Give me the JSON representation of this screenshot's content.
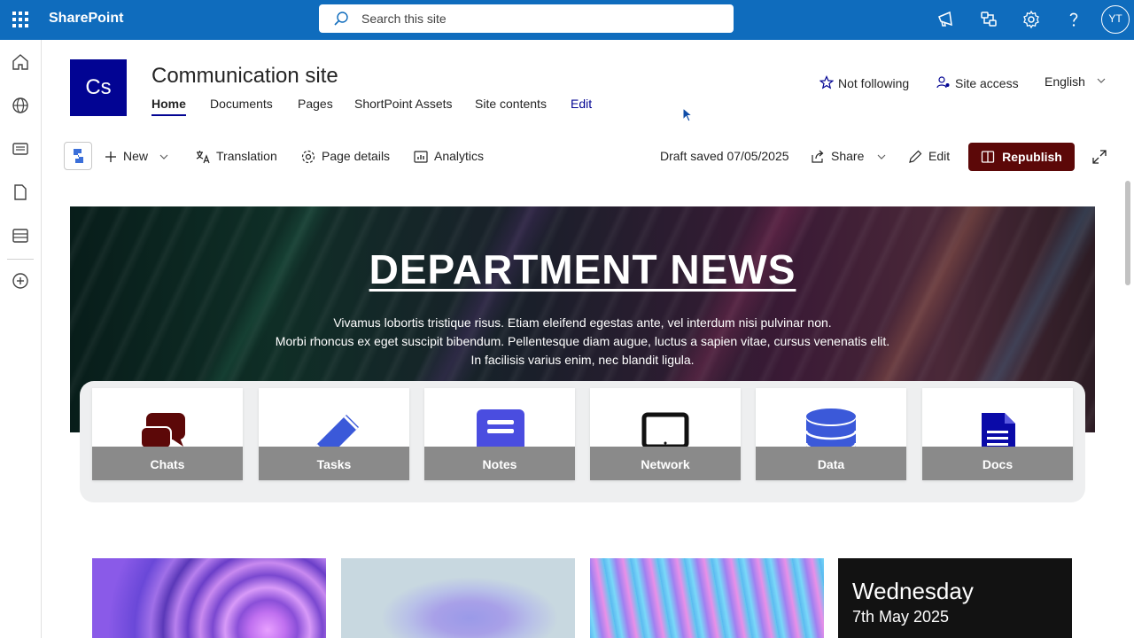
{
  "suitebar": {
    "brand": "SharePoint",
    "search_placeholder": "Search this site",
    "avatar": "YT"
  },
  "site": {
    "logo_text": "Cs",
    "title": "Communication site",
    "nav": [
      {
        "label": "Home"
      },
      {
        "label": "Documents"
      },
      {
        "label": "Pages"
      },
      {
        "label": "ShortPoint Assets"
      },
      {
        "label": "Site contents"
      },
      {
        "label": "Edit"
      }
    ],
    "follow_label": "Not following",
    "access_label": "Site access",
    "language": "English"
  },
  "commandbar": {
    "new_label": "New",
    "translation_label": "Translation",
    "page_details_label": "Page details",
    "analytics_label": "Analytics",
    "draft_status": "Draft saved 07/05/2025",
    "share_label": "Share",
    "edit_label": "Edit",
    "republish_label": "Republish"
  },
  "hero": {
    "title": "DEPARTMENT NEWS",
    "body_lines": [
      "Vivamus lobortis tristique risus. Etiam eleifend egestas ante, vel interdum nisi pulvinar non.",
      "Morbi rhoncus ex eget suscipit bibendum. Pellentesque diam augue, luctus a sapien vitae, cursus venenatis elit.",
      "In facilisis varius enim, nec blandit ligula."
    ]
  },
  "tiles": [
    {
      "label": "Chats",
      "icon": "chat-bubbles-icon",
      "color": "#5c0808"
    },
    {
      "label": "Tasks",
      "icon": "pencil-icon",
      "color": "#3b59d9"
    },
    {
      "label": "Notes",
      "icon": "book-icon",
      "color": "#4a4de0"
    },
    {
      "label": "Network",
      "icon": "laptop-icon",
      "color": "#111111"
    },
    {
      "label": "Data",
      "icon": "database-icon",
      "color": "#3b59d9"
    },
    {
      "label": "Docs",
      "icon": "document-icon",
      "color": "#0a0aa8"
    }
  ],
  "date_card": {
    "day": "Wednesday",
    "date": "7th May 2025"
  },
  "colors": {
    "suitebar": "#0f6cbd",
    "brand_navy": "#020493",
    "republish": "#5c0808"
  }
}
